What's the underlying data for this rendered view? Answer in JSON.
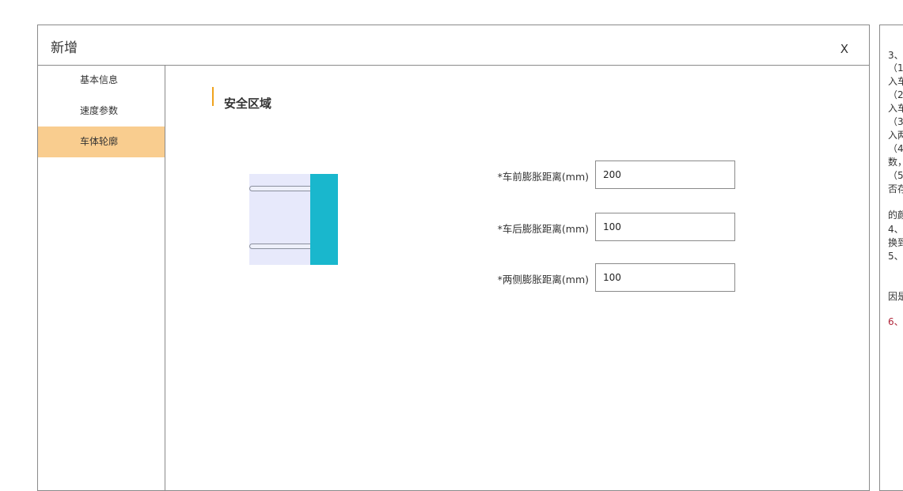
{
  "dialog": {
    "title": "新增",
    "close_label": "X"
  },
  "sidebar": {
    "items": [
      {
        "label": "基本信息"
      },
      {
        "label": "速度参数"
      },
      {
        "label": "车体轮廓"
      }
    ]
  },
  "section": {
    "title": "安全区域"
  },
  "form": {
    "front": {
      "label": "*车前膨胀距离(mm)",
      "value": "200"
    },
    "rear": {
      "label": "*车后膨胀距离(mm)",
      "value": "100"
    },
    "side": {
      "label": "*两侧膨胀距离(mm)",
      "value": "100"
    }
  },
  "colors": {
    "active_tab": "#f9cd8f",
    "heading_accent": "#f0a31e",
    "vehicle_body": "#19b7cd",
    "vehicle_zone": "#e7e9fb"
  },
  "side_notes": {
    "lines": [
      "3、",
      "（1",
      "入车",
      "（2",
      "入车",
      "（3",
      "入两",
      "（4",
      "数，",
      "（5",
      "否存",
      "的颜",
      "4、",
      "换到",
      "5、",
      "因是",
      "6、"
    ]
  }
}
